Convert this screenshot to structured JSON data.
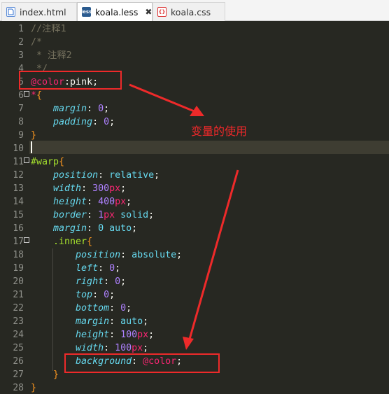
{
  "tabs": [
    {
      "name": "index.html",
      "icon": "html-file-icon",
      "active": false
    },
    {
      "name": "koala.less",
      "icon": "less-file-icon",
      "icon_text": "less",
      "active": true,
      "close": "✖"
    },
    {
      "name": "koala.css",
      "icon": "css-file-icon",
      "icon_text": "{}",
      "active": false
    }
  ],
  "line_numbers": [
    "1",
    "2",
    "3",
    "4",
    "5",
    "6",
    "7",
    "8",
    "9",
    "10",
    "11",
    "12",
    "13",
    "14",
    "15",
    "16",
    "17",
    "18",
    "19",
    "20",
    "21",
    "22",
    "23",
    "24",
    "25",
    "26",
    "27",
    "28"
  ],
  "code": {
    "l1": "//注释1",
    "l2": "/*",
    "l3": " * 注释2",
    "l4": " */",
    "l5_var": "@color",
    "l5_rest": ":pink;",
    "l6_sel": "*",
    "l6_brace": "{",
    "l7_prop": "margin",
    "l7_val": "0",
    "l8_prop": "padding",
    "l8_val": "0",
    "l9": "}",
    "l11_sel": "#warp",
    "l11_brace": "{",
    "l12_prop": "position",
    "l12_val": "relative",
    "l13_prop": "width",
    "l13_num": "300",
    "l13_unit": "px",
    "l14_prop": "height",
    "l14_num": "400",
    "l14_unit": "px",
    "l15_prop": "border",
    "l15_num": "1",
    "l15_unit": "px",
    "l15_rest": "solid",
    "l16_prop": "margin",
    "l16_val": "0 auto",
    "l17_sel": ".inner",
    "l17_brace": "{",
    "l18_prop": "position",
    "l18_val": "absolute",
    "l19_prop": "left",
    "l19_val": "0",
    "l20_prop": "right",
    "l20_val": "0",
    "l21_prop": "top",
    "l21_val": "0",
    "l22_prop": "bottom",
    "l22_val": "0",
    "l23_prop": "margin",
    "l23_val": "auto",
    "l24_prop": "height",
    "l24_num": "100",
    "l24_unit": "px",
    "l25_prop": "width",
    "l25_num": "100",
    "l25_unit": "px",
    "l26_prop": "background",
    "l26_var": "@color",
    "l27": "}",
    "l28": "}"
  },
  "annotation": "变量的使用",
  "colors": {
    "annotation_red": "#ee2a2a",
    "editor_bg": "#272822"
  }
}
